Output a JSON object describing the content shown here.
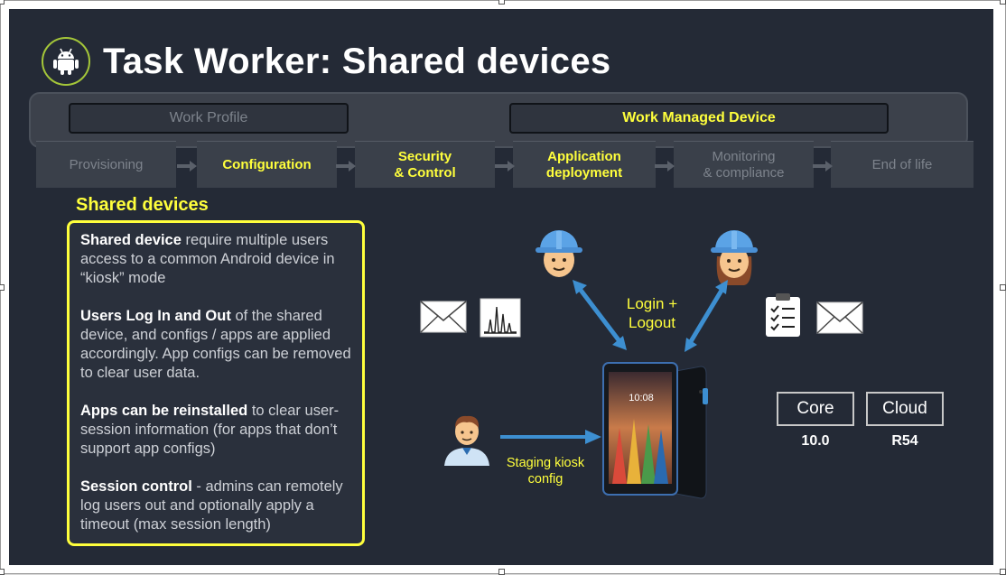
{
  "title": "Task Worker: Shared devices",
  "modes": [
    {
      "label": "Work Profile",
      "active": false
    },
    {
      "label": "Work Managed Device",
      "active": true
    }
  ],
  "stages": [
    {
      "line1": "Provisioning",
      "line2": "",
      "active": false
    },
    {
      "line1": "Configuration",
      "line2": "",
      "active": true
    },
    {
      "line1": "Security",
      "line2": "& Control",
      "active": true
    },
    {
      "line1": "Application",
      "line2": "deployment",
      "active": true
    },
    {
      "line1": "Monitoring",
      "line2": "& compliance",
      "active": false
    },
    {
      "line1": "End of life",
      "line2": "",
      "active": false
    }
  ],
  "panel": {
    "heading": "Shared devices",
    "items": [
      {
        "bold": "Shared device",
        "text": " require multiple users access to a common Android device in “kiosk” mode"
      },
      {
        "bold": "Users Log In and Out",
        "text": " of the shared device, and configs / apps are applied accordingly. App configs can be removed to clear user data."
      },
      {
        "bold": "Apps can be reinstalled",
        "text": " to clear user-session information (for apps that don’t support app configs)"
      },
      {
        "bold": "Session control",
        "text": " - admins can remotely log users out and optionally apply a timeout (max session length)"
      }
    ]
  },
  "diagram": {
    "login_line1": "Login +",
    "login_line2": "Logout",
    "staging_line1": "Staging kiosk",
    "staging_line2": "config",
    "tablet_clock": "10:08",
    "icons": [
      "android-icon",
      "envelope-icon",
      "chart-icon",
      "clipboard-checklist-icon",
      "envelope-icon",
      "worker-helmet-icon",
      "admin-person-icon",
      "tablet-icon"
    ]
  },
  "badges": [
    {
      "label": "Core",
      "value": "10.0"
    },
    {
      "label": "Cloud",
      "value": "R54"
    }
  ],
  "colors": {
    "accent": "#ffff3c",
    "android_green": "#a4c639",
    "arrow_blue": "#3d8fd1",
    "slide_bg": "#242a36"
  }
}
